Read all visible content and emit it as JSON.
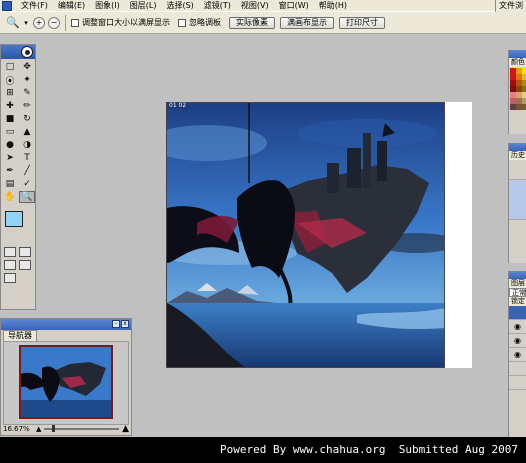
{
  "menubar": {
    "items": [
      "文件(F)",
      "编辑(E)",
      "图象(I)",
      "图层(L)",
      "选择(S)",
      "滤镜(T)",
      "视图(V)",
      "窗口(W)",
      "帮助(H)"
    ],
    "file_browser": "文件浏"
  },
  "options_bar": {
    "checkbox_resize": "调整窗口大小以满屏显示",
    "checkbox_ignore_palettes": "忽略调板",
    "btn_actual_pixels": "实际像素",
    "btn_fit_screen": "满画布显示",
    "btn_print_size": "打印尺寸"
  },
  "document": {
    "tab_label": "01 02"
  },
  "navigator": {
    "tab_label": "导航器",
    "zoom": "16.67%"
  },
  "right_panels": {
    "color_tab": "颜色",
    "history_tab": "历史",
    "layers_tab": "图层",
    "blend_mode": "正常",
    "lock_label": "锁定"
  },
  "footer": {
    "text": "Powered By www.chahua.org  Submitted Aug 2007"
  },
  "colors": {
    "foreground": "#8fd4f5",
    "background": "#ffffff",
    "title_blue": "#3a63b8"
  }
}
